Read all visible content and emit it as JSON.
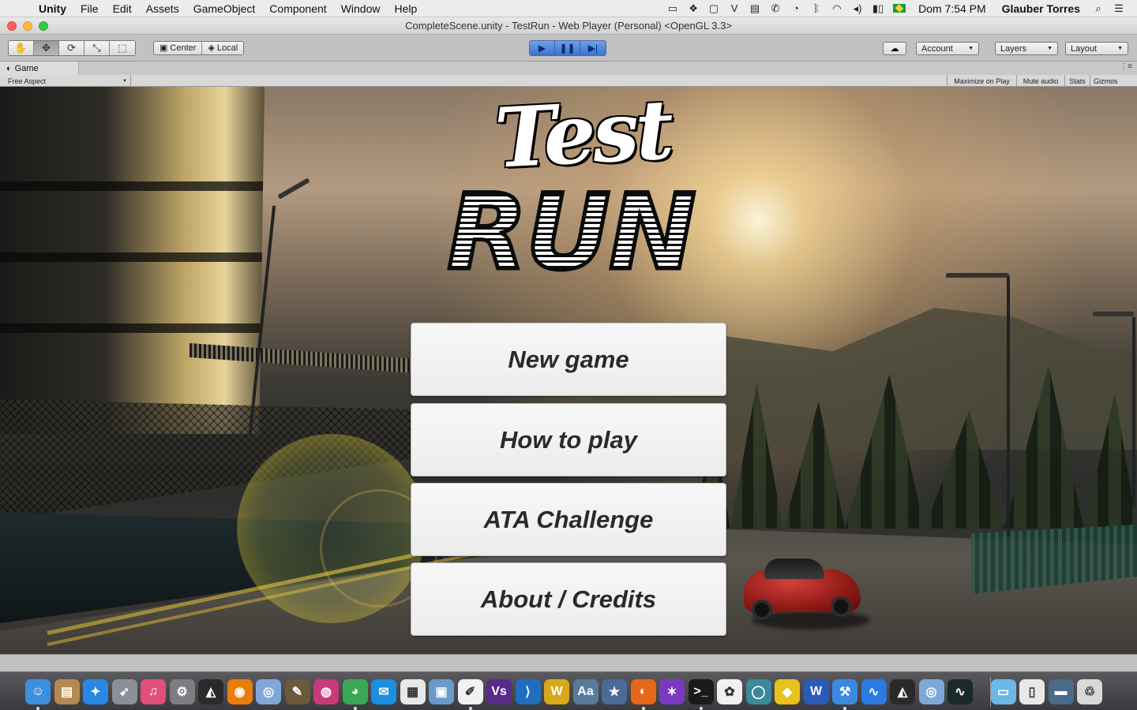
{
  "menubar": {
    "apple_glyph": "",
    "app_name": "Unity",
    "items": [
      "File",
      "Edit",
      "Assets",
      "GameObject",
      "Component",
      "Window",
      "Help"
    ],
    "status_icons": [
      {
        "icon": "video-camera-icon",
        "glyph": "▭"
      },
      {
        "icon": "dropbox-icon",
        "glyph": "❖"
      },
      {
        "icon": "window-icon",
        "glyph": "▢"
      },
      {
        "icon": "vim-icon",
        "glyph": "V"
      },
      {
        "icon": "scanner-icon",
        "glyph": "▤"
      },
      {
        "icon": "phone-icon",
        "glyph": "✆"
      },
      {
        "icon": "time-machine-icon",
        "glyph": "◔"
      },
      {
        "icon": "bluetooth-icon",
        "glyph": "ᛒ"
      },
      {
        "icon": "wifi-icon",
        "glyph": "◠"
      },
      {
        "icon": "volume-icon",
        "glyph": "◂)"
      },
      {
        "icon": "battery-icon",
        "glyph": "▮▯"
      }
    ],
    "flag_color": "#1c9a3b",
    "clock": "Dom 7:54 PM",
    "user": "Glauber Torres",
    "spotlight_glyph": "⌕",
    "list_glyph": "☰"
  },
  "window": {
    "title": "CompleteScene.unity - TestRun - Web Player (Personal) <OpenGL 3.3>"
  },
  "toolbar": {
    "tools": [
      {
        "name": "hand-tool-icon",
        "glyph": "✋"
      },
      {
        "name": "move-tool-icon",
        "glyph": "✥"
      },
      {
        "name": "rotate-tool-icon",
        "glyph": "⟳"
      },
      {
        "name": "scale-tool-icon",
        "glyph": "⤡"
      },
      {
        "name": "rect-tool-icon",
        "glyph": "⬚"
      }
    ],
    "pivot_label": "Center",
    "pivot_glyph": "▣",
    "space_label": "Local",
    "space_glyph": "◈",
    "play_glyph": "▶",
    "pause_glyph": "❚❚",
    "step_glyph": "▶|",
    "cloud_glyph": "☁",
    "account_label": "Account",
    "layers_label": "Layers",
    "layout_label": "Layout",
    "caret": "▼",
    "accent_color": "#3a74cf"
  },
  "game_view": {
    "tab_glyph": "◐",
    "tab_label": "Game",
    "tab_menu_glyph": "⋮≡",
    "aspect_label": "Free Aspect",
    "maximize_label": "Maximize on Play",
    "mute_label": "Mute audio",
    "stats_label": "Stats",
    "gizmos_label": "Gizmos"
  },
  "game": {
    "logo_top": "Test",
    "logo_bottom": "RUN",
    "buttons": [
      {
        "id": "new-game-button",
        "label": "New game"
      },
      {
        "id": "how-to-play-button",
        "label": "How to play"
      },
      {
        "id": "ata-challenge-button",
        "label": "ATA Challenge"
      },
      {
        "id": "about-credits-button",
        "label": "About / Credits"
      }
    ]
  },
  "dock": {
    "items": [
      {
        "name": "finder-icon",
        "glyph": "☺",
        "color": "#3d8fe0"
      },
      {
        "name": "notes-app-icon",
        "glyph": "▤",
        "color": "#b58a52"
      },
      {
        "name": "safari-icon",
        "glyph": "✦",
        "color": "#2b87e6"
      },
      {
        "name": "launchpad-icon",
        "glyph": "➶",
        "color": "#8a8f9a"
      },
      {
        "name": "itunes-icon",
        "glyph": "♫",
        "color": "#e0507a"
      },
      {
        "name": "system-preferences-icon",
        "glyph": "⚙",
        "color": "#7e7e82"
      },
      {
        "name": "unity-icon",
        "glyph": "◭",
        "color": "#2a2a2a"
      },
      {
        "name": "blender-icon",
        "glyph": "◉",
        "color": "#e87d0d"
      },
      {
        "name": "remote-desktop-icon",
        "glyph": "◎",
        "color": "#7fa8d8"
      },
      {
        "name": "gimp-icon",
        "glyph": "✎",
        "color": "#6b5a3a"
      },
      {
        "name": "audio-app-icon",
        "glyph": "◍",
        "color": "#c93a7a"
      },
      {
        "name": "chrome-icon",
        "glyph": "◕",
        "color": "#3aa757"
      },
      {
        "name": "skype-icon",
        "glyph": "✉",
        "color": "#1a8fe0"
      },
      {
        "name": "launch-grid-icon",
        "glyph": "▦",
        "color": "#e8e8e8"
      },
      {
        "name": "photo-app-icon",
        "glyph": "▣",
        "color": "#6a9ac8"
      },
      {
        "name": "textedit-icon",
        "glyph": "✐",
        "color": "#f2f2f2"
      },
      {
        "name": "vs-icon",
        "glyph": "Vs",
        "color": "#5a2a8a"
      },
      {
        "name": "visual-studio-code-icon",
        "glyph": "⟩",
        "color": "#1e6fc0"
      },
      {
        "name": "wifi-explorer-icon",
        "glyph": "W",
        "color": "#d8a81a"
      },
      {
        "name": "dictionary-icon",
        "glyph": "Aa",
        "color": "#5a7a9a"
      },
      {
        "name": "imovie-icon",
        "glyph": "★",
        "color": "#4a6a9a"
      },
      {
        "name": "firefox-icon",
        "glyph": "◐",
        "color": "#e6661a"
      },
      {
        "name": "imovie-star-icon",
        "glyph": "✶",
        "color": "#7a3ac0"
      },
      {
        "name": "terminal-icon",
        "glyph": ">_",
        "color": "#1a1a1a"
      },
      {
        "name": "photos-icon",
        "glyph": "✿",
        "color": "#f0f0f0"
      },
      {
        "name": "ring-app-icon",
        "glyph": "◯",
        "color": "#3a8a9a"
      },
      {
        "name": "cyberduck-icon",
        "glyph": "◆",
        "color": "#e6c21a"
      },
      {
        "name": "word-icon",
        "glyph": "W",
        "color": "#2b5bb8"
      },
      {
        "name": "xcode-icon",
        "glyph": "⚒",
        "color": "#3a8ae0"
      },
      {
        "name": "instruments-icon",
        "glyph": "∿",
        "color": "#2a7ae0"
      },
      {
        "name": "unity-2-icon",
        "glyph": "◭",
        "color": "#2a2a2a"
      },
      {
        "name": "remote-desktop-2-icon",
        "glyph": "◎",
        "color": "#7fa8d8"
      },
      {
        "name": "activity-monitor-icon",
        "glyph": "∿",
        "color": "#1a2a2a"
      },
      {
        "name": "downloads-folder-icon",
        "glyph": "▭",
        "color": "#6ab8e8"
      },
      {
        "name": "documents-icon",
        "glyph": "▯",
        "color": "#e8e8e8"
      },
      {
        "name": "terminal-window-icon",
        "glyph": "▬",
        "color": "#4a6a8a"
      },
      {
        "name": "trash-icon",
        "glyph": "♲",
        "color": "#d8d8d8"
      }
    ]
  }
}
